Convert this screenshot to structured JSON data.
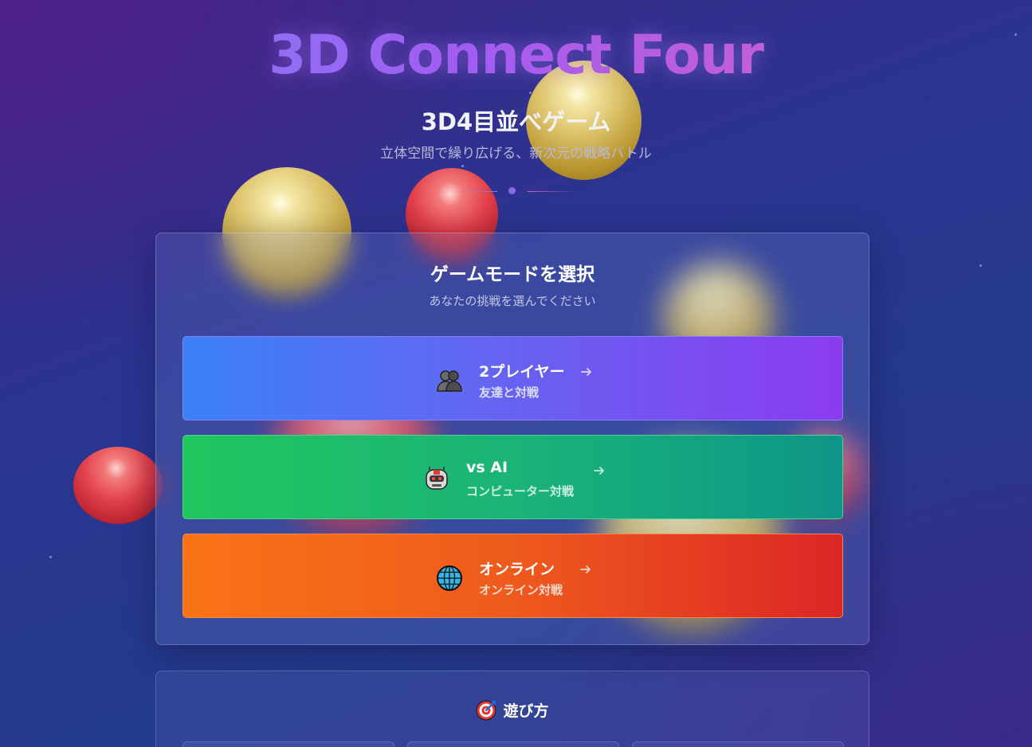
{
  "header": {
    "title": "3D Connect Four",
    "subtitle": "3D4目並べゲーム",
    "tagline": "立体空間で繰り広げる、新次元の戦略バトル"
  },
  "mode_panel": {
    "title": "ゲームモードを選択",
    "subtitle": "あなたの挑戦を選んでください",
    "modes": [
      {
        "icon": "two-people-icon",
        "label": "2プレイヤー",
        "desc": "友達と対戦",
        "color_from": "#3b82f6",
        "color_to": "#8b3cf0"
      },
      {
        "icon": "robot-icon",
        "label": "vs AI",
        "desc": "コンピューター対戦",
        "color_from": "#22c55e",
        "color_to": "#0e9688"
      },
      {
        "icon": "globe-icon",
        "label": "オンライン",
        "desc": "オンライン対戦",
        "color_from": "#f97316",
        "color_to": "#dc2626"
      }
    ]
  },
  "howto": {
    "icon": "target-icon",
    "title": "遊び方"
  },
  "colors": {
    "title_gradient": [
      "#7a86f5",
      "#a25cf2",
      "#dd5db4"
    ],
    "gold_piece": "#dcc26a",
    "red_piece": "#e2404a"
  }
}
